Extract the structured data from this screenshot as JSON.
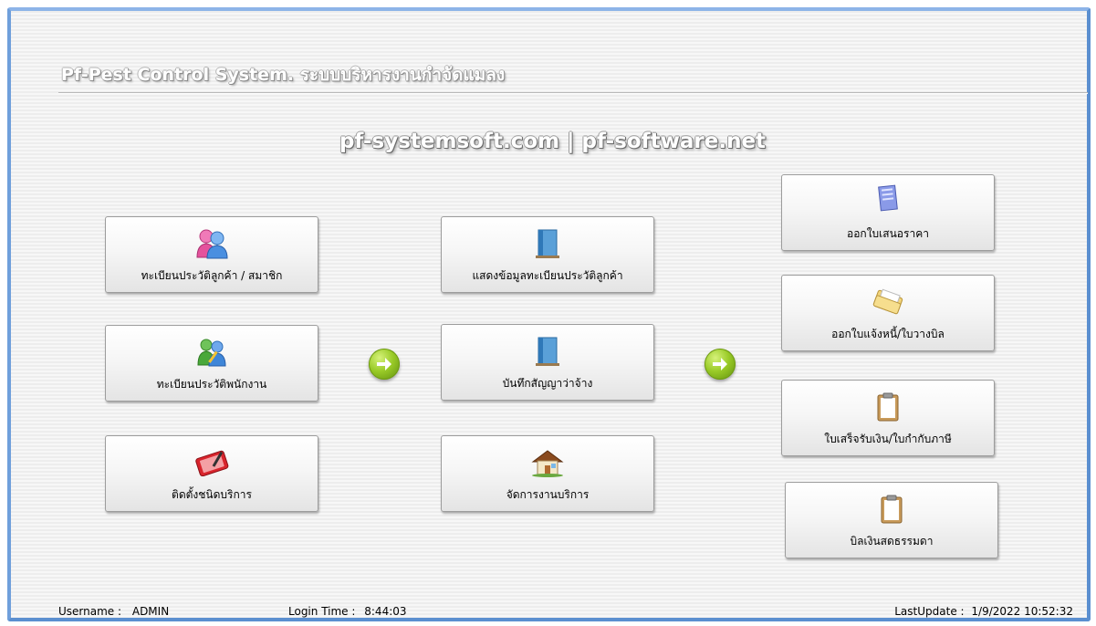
{
  "header": {
    "app_title": "Pf-Pest Control System. ระบบบริหารงานกำจัดแมลง",
    "website": "pf-systemsoft.com | pf-software.net"
  },
  "left_column": [
    {
      "label": "ทะเบียนประวัติลูกค้า / สมาชิก",
      "icon": "customers-icon"
    },
    {
      "label": "ทะเบียนประวัติพนักงาน",
      "icon": "employees-icon"
    },
    {
      "label": "ติดตั้งชนิดบริการ",
      "icon": "tablet-icon"
    }
  ],
  "middle_column": [
    {
      "label": "แสดงข้อมูลทะเบียนประวัติลูกค้า",
      "icon": "book-icon"
    },
    {
      "label": "บันทึกสัญญาว่าจ้าง",
      "icon": "book-icon"
    },
    {
      "label": "จัดการงานบริการ",
      "icon": "house-icon"
    }
  ],
  "right_column": [
    {
      "label": "ออกใบเสนอราคา",
      "icon": "notepad-icon"
    },
    {
      "label": "ออกใบแจ้งหนี้/ใบวางบิล",
      "icon": "folder-icon"
    },
    {
      "label": "ใบเสร็จรับเงิน/ใบกำกับภาษี",
      "icon": "clipboard-icon"
    },
    {
      "label": "บิลเงินสดธรรมดา",
      "icon": "clipboard-icon"
    }
  ],
  "status_bar": {
    "username_label": "Username :",
    "username_value": "ADMIN",
    "login_label": "Login Time :",
    "login_value": "8:44:03",
    "last_update_label": "LastUpdate :",
    "last_update_value": "1/9/2022 10:52:32"
  },
  "colors": {
    "frame_border": "#5b8fd0",
    "arrow_green": "#9acb28"
  }
}
